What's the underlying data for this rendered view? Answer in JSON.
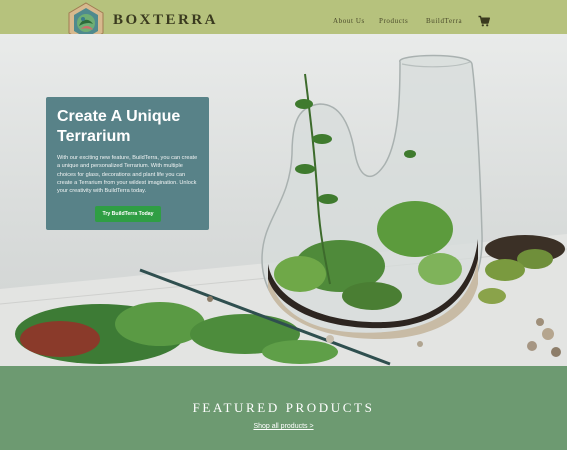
{
  "header": {
    "brand": "BoxTerra",
    "nav": [
      "About Us",
      "Products",
      "BuildTerra"
    ]
  },
  "icons": {
    "logo": "terrarium-hexagon-logo-icon",
    "cart": "shopping-cart-icon"
  },
  "hero": {
    "title": "Create A Unique Terrarium",
    "description": "With our exciting new feature, BuildTerra, you can create a unique and personalized Terrarium. With multiple choices for glass, decorations and plant life you can create a Terrarium from your wildest imagination. Unlock your creativity with BuildTerra today.",
    "button_label": "Try BuildTerra Today"
  },
  "featured": {
    "title": "Featured Products",
    "link_label": "Shop all products >"
  },
  "colors": {
    "header_bg": "#b6c27d",
    "card_bg": "#4d7b81",
    "button_bg": "#2f9e44",
    "featured_bg": "#6d9a71"
  }
}
